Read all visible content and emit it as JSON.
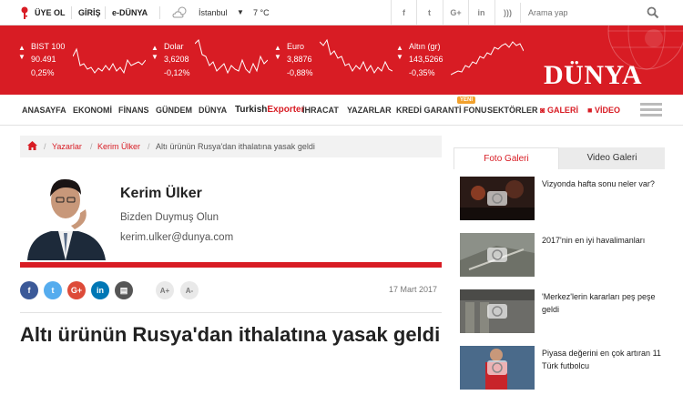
{
  "topbar": {
    "register": "ÜYE OL",
    "login": "GİRİŞ",
    "edunya": "e-DÜNYA",
    "city": "İstanbul",
    "temperature": "7 °C",
    "social": [
      {
        "name": "facebook-icon",
        "glyph": "f"
      },
      {
        "name": "twitter-icon",
        "glyph": "t"
      },
      {
        "name": "google-plus-icon",
        "glyph": "G+"
      },
      {
        "name": "linkedin-icon",
        "glyph": "in"
      },
      {
        "name": "rss-icon",
        "glyph": ")))"
      }
    ],
    "search_placeholder": "Arama yap"
  },
  "market": [
    {
      "name": "BIST 100",
      "value": "90.491",
      "change": "0,25%",
      "direction": "up"
    },
    {
      "name": "Dolar",
      "value": "3,6208",
      "change": "-0,12%",
      "direction": "down"
    },
    {
      "name": "Euro",
      "value": "3,8876",
      "change": "-0,88%",
      "direction": "down"
    },
    {
      "name": "Altın (gr)",
      "value": "143,5266",
      "change": "-0,35%",
      "direction": "down"
    }
  ],
  "logo": "DÜNYA",
  "nav": {
    "items": [
      "ANASAYFA",
      "EKONOMİ",
      "FİNANS",
      "GÜNDEM",
      "DÜNYA"
    ],
    "turkish": "Turkish",
    "exporter": "Exporter",
    "items2": [
      "İHRACAT",
      "YAZARLAR",
      "KREDİ GARANTİ FONU",
      "SEKTÖRLER"
    ],
    "new_badge": "YENİ",
    "gallery": "GALERİ",
    "video": "VİDEO"
  },
  "breadcrumb": {
    "writers": "Yazarlar",
    "author": "Kerim Ülker",
    "current": "Altı ürünün Rusya'dan ithalatına yasak geldi"
  },
  "author": {
    "name": "Kerim Ülker",
    "column": "Bizden Duymuş Olun",
    "email": "kerim.ulker@dunya.com"
  },
  "share": {
    "font_plus": "A+",
    "font_minus": "A-",
    "date": "17 Mart 2017"
  },
  "article": {
    "headline": "Altı ürünün Rusya'dan ithalatına yasak geldi"
  },
  "gallery": {
    "tab_photo": "Fotо Galeri",
    "tab_video": "Video Galeri",
    "items": [
      {
        "caption": "Vizyonda hafta sonu neler var?"
      },
      {
        "caption": "2017'nin en iyi havalimanları"
      },
      {
        "caption": "'Merkez'lerin kararları peş peşe geldi"
      },
      {
        "caption": "Piyasa değerini en çok artıran 11 Türk futbolcu"
      }
    ]
  },
  "colors": {
    "brand_red": "#d81c24",
    "badge_orange": "#f2a12d"
  }
}
